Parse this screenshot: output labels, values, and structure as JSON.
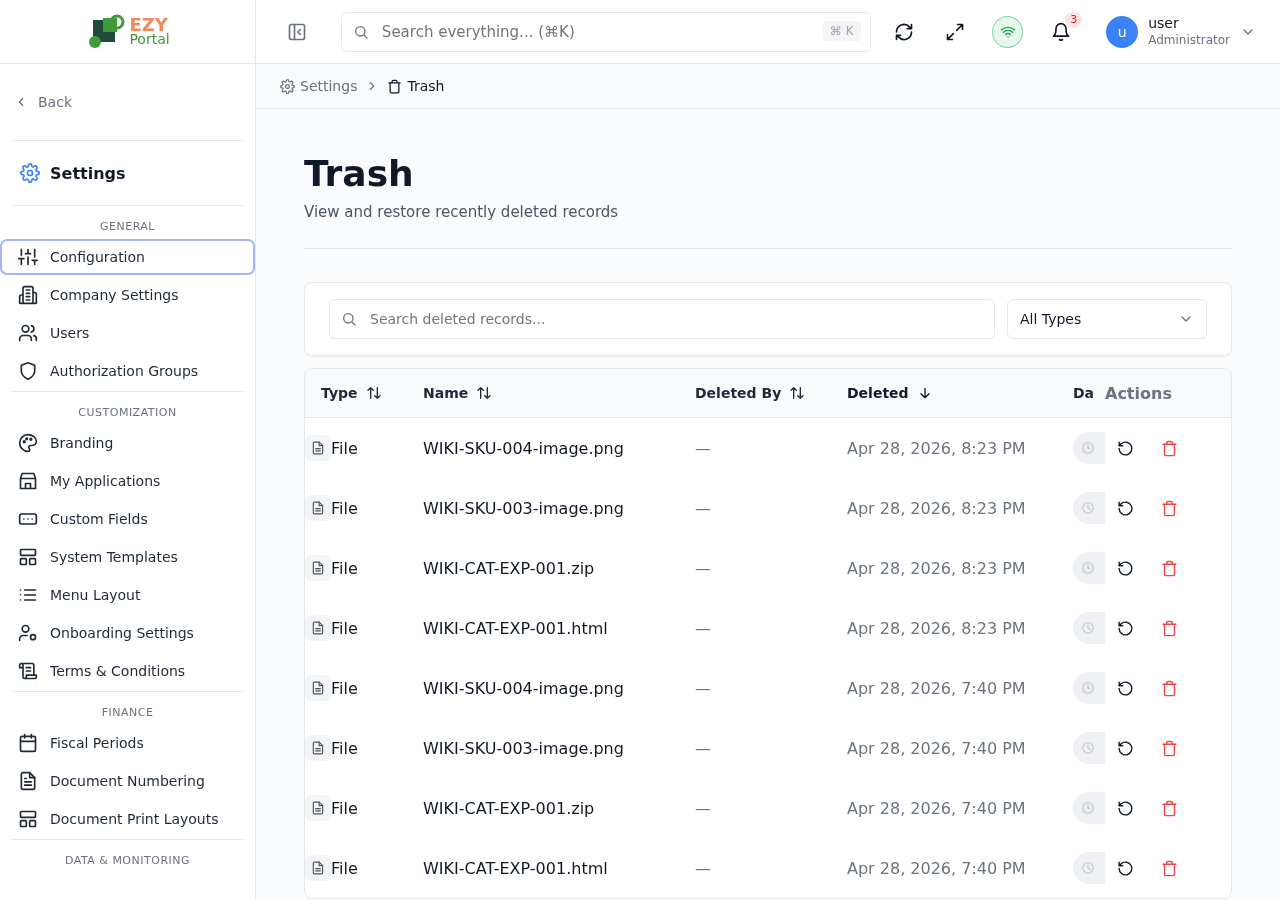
{
  "logo": {
    "line1": "EZY",
    "line2": "Portal"
  },
  "topbar": {
    "search_placeholder": "Search everything... (⌘K)",
    "shortcut": "⌘ K",
    "notifications": "3",
    "user": {
      "initial": "u",
      "name": "user",
      "role": "Administrator"
    }
  },
  "sidebar": {
    "back": "Back",
    "title": "Settings",
    "sections": [
      {
        "label": "GENERAL",
        "items": [
          {
            "label": "Configuration",
            "selected": true
          },
          {
            "label": "Company Settings",
            "selected": false
          },
          {
            "label": "Users",
            "selected": false
          },
          {
            "label": "Authorization Groups",
            "selected": false
          }
        ]
      },
      {
        "label": "CUSTOMIZATION",
        "items": [
          {
            "label": "Branding",
            "selected": false
          },
          {
            "label": "My Applications",
            "selected": false
          },
          {
            "label": "Custom Fields",
            "selected": false
          },
          {
            "label": "System Templates",
            "selected": false
          },
          {
            "label": "Menu Layout",
            "selected": false
          },
          {
            "label": "Onboarding Settings",
            "selected": false
          },
          {
            "label": "Terms & Conditions",
            "selected": false
          }
        ]
      },
      {
        "label": "FINANCE",
        "items": [
          {
            "label": "Fiscal Periods",
            "selected": false
          },
          {
            "label": "Document Numbering",
            "selected": false
          },
          {
            "label": "Document Print Layouts",
            "selected": false
          }
        ]
      },
      {
        "label": "DATA & MONITORING"
      }
    ]
  },
  "breadcrumb": [
    "Settings",
    "Trash"
  ],
  "page": {
    "title": "Trash",
    "subtitle": "View and restore recently deleted records"
  },
  "filters": {
    "search_placeholder": "Search deleted records...",
    "type_filter": "All Types"
  },
  "table": {
    "columns": [
      {
        "label": "Type",
        "sortable": true,
        "sorted": false
      },
      {
        "label": "Name",
        "sortable": true,
        "sorted": false
      },
      {
        "label": "Deleted By",
        "sortable": true,
        "sorted": false
      },
      {
        "label": "Deleted",
        "sortable": true,
        "sorted": true
      },
      {
        "label": "Da",
        "sortable": false,
        "sorted": false
      },
      {
        "label": "Actions",
        "sortable": false,
        "sorted": false
      }
    ],
    "rows": [
      {
        "type": "File",
        "name": "WIKI-SKU-004-image.png",
        "deleted_by": "—",
        "deleted": "Apr 28, 2026, 8:23 PM"
      },
      {
        "type": "File",
        "name": "WIKI-SKU-003-image.png",
        "deleted_by": "—",
        "deleted": "Apr 28, 2026, 8:23 PM"
      },
      {
        "type": "File",
        "name": "WIKI-CAT-EXP-001.zip",
        "deleted_by": "—",
        "deleted": "Apr 28, 2026, 8:23 PM"
      },
      {
        "type": "File",
        "name": "WIKI-CAT-EXP-001.html",
        "deleted_by": "—",
        "deleted": "Apr 28, 2026, 8:23 PM"
      },
      {
        "type": "File",
        "name": "WIKI-SKU-004-image.png",
        "deleted_by": "—",
        "deleted": "Apr 28, 2026, 7:40 PM"
      },
      {
        "type": "File",
        "name": "WIKI-SKU-003-image.png",
        "deleted_by": "—",
        "deleted": "Apr 28, 2026, 7:40 PM"
      },
      {
        "type": "File",
        "name": "WIKI-CAT-EXP-001.zip",
        "deleted_by": "—",
        "deleted": "Apr 28, 2026, 7:40 PM"
      },
      {
        "type": "File",
        "name": "WIKI-CAT-EXP-001.html",
        "deleted_by": "—",
        "deleted": "Apr 28, 2026, 7:40 PM"
      }
    ]
  }
}
